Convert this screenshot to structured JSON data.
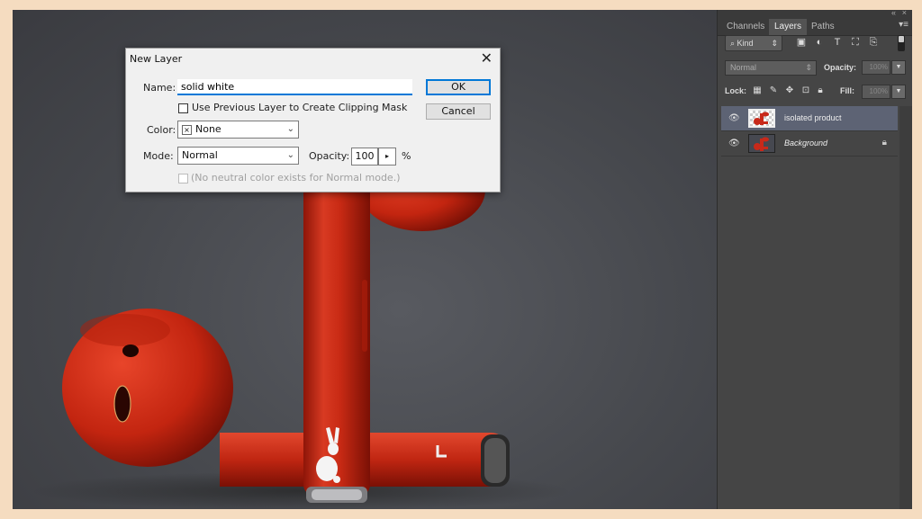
{
  "dialog": {
    "title": "New Layer",
    "name_label": "Name:",
    "name_value": "solid white",
    "clipping_label": "Use Previous Layer to Create Clipping Mask",
    "color_label": "Color:",
    "color_value": "None",
    "mode_label": "Mode:",
    "mode_value": "Normal",
    "opacity_label": "Opacity:",
    "opacity_value": "100",
    "opacity_unit": "%",
    "neutral_label": "(No neutral color exists for Normal mode.)",
    "ok_label": "OK",
    "cancel_label": "Cancel",
    "close_glyph": "✕"
  },
  "panel": {
    "tabs": [
      {
        "label": "Channels"
      },
      {
        "label": "Layers"
      },
      {
        "label": "Paths"
      }
    ],
    "kind_label": "Kind",
    "blend_mode": "Normal",
    "opacity_label": "Opacity:",
    "opacity_value": "100%",
    "lock_label": "Lock:",
    "fill_label": "Fill:",
    "fill_value": "100%",
    "layers": [
      {
        "name": "isolated product"
      },
      {
        "name": "Background"
      }
    ]
  },
  "colors": {
    "accent": "#0078d7",
    "product_red": "#d42a16",
    "selected_layer": "#5d6374"
  }
}
